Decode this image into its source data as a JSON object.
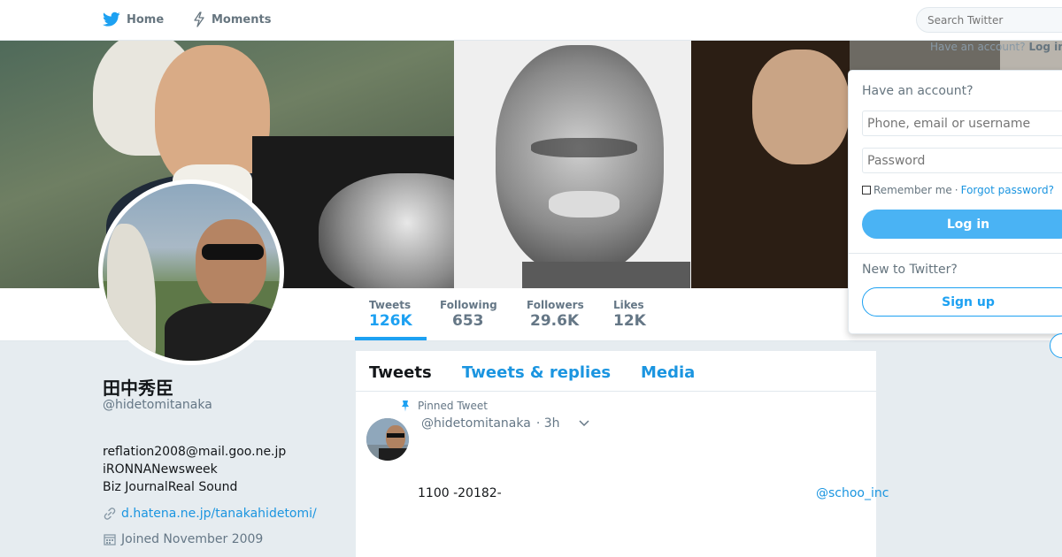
{
  "nav": {
    "home_label": "Home",
    "moments_label": "Moments",
    "search_placeholder": "Search Twitter",
    "have_account_label": "Have an account?",
    "login_label": "Log in"
  },
  "profile": {
    "display_name": "田中秀臣",
    "handle": "@hidetomitanaka",
    "bio_lines": [
      "reflation2008@mail.goo.ne.jp",
      "iRONNANewsweek",
      "Biz JournalReal Sound"
    ],
    "website": "d.hatena.ne.jp/tanakahidetomi/",
    "joined": "Joined November 2009"
  },
  "stats": [
    {
      "label": "Tweets",
      "value": "126K"
    },
    {
      "label": "Following",
      "value": "653"
    },
    {
      "label": "Followers",
      "value": "29.6K"
    },
    {
      "label": "Likes",
      "value": "12K"
    }
  ],
  "timeline": {
    "tabs": [
      "Tweets",
      "Tweets & replies",
      "Media"
    ],
    "pinned_label": "Pinned Tweet",
    "tweet": {
      "handle": "@hidetomitanaka",
      "time": "· 3h",
      "text": "1100 -20182-",
      "mention": "@schoo_inc"
    }
  },
  "login_panel": {
    "title": "Have an account?",
    "username_placeholder": "Phone, email or username",
    "password_placeholder": "Password",
    "remember_label": "Remember me",
    "separator": "·",
    "forgot_label": "Forgot password?",
    "login_button": "Log in",
    "new_label": "New to Twitter?",
    "signup_button": "Sign up"
  },
  "colors": {
    "accent": "#1da1f2",
    "link": "#1b95e0",
    "page_bg": "#e6ecf0"
  }
}
